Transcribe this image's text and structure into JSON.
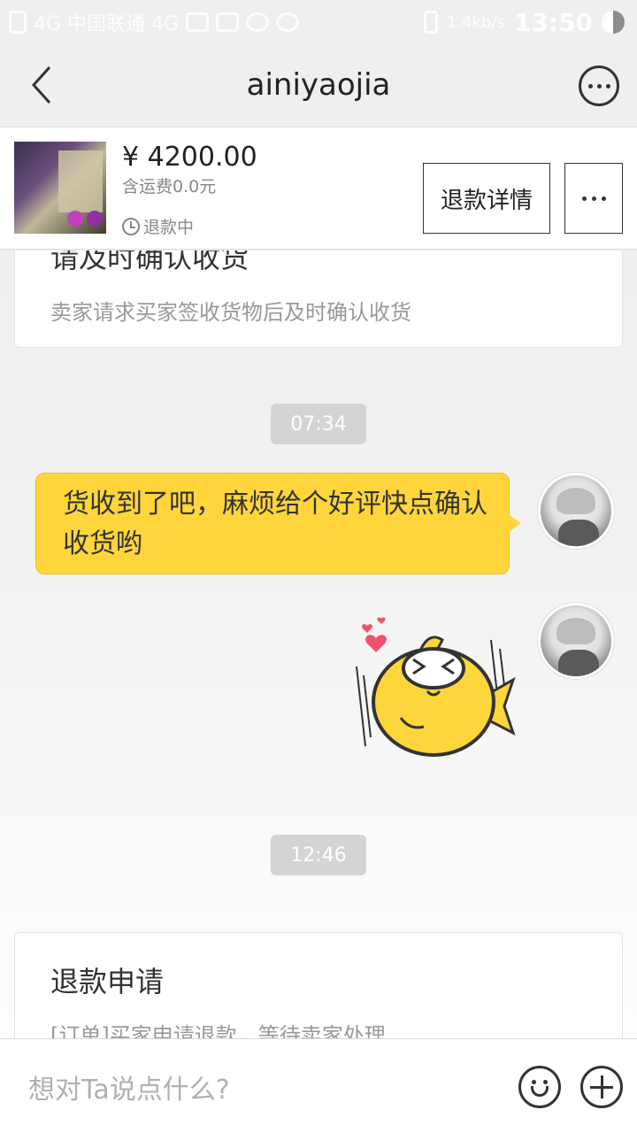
{
  "status_bar": {
    "left_text": "4G 中国联通 4G",
    "speed": "1.4kb/s",
    "time": "13:50"
  },
  "nav": {
    "title": "ainiyaojia"
  },
  "product": {
    "price": "¥ 4200.00",
    "shipping": "含运费0.0元",
    "status": "退款中",
    "refund_button": "退款详情"
  },
  "chat": {
    "card1": {
      "title": "请及时确认收货",
      "desc": "卖家请求买家签收货物后及时确认收货"
    },
    "time1": "07:34",
    "message1": "货收到了吧，麻烦给个好评快点确认收货哟",
    "time2": "12:46",
    "card2": {
      "title": "退款申请",
      "desc": "[订单]买家申请退款，等待卖家处理"
    }
  },
  "input": {
    "placeholder": "想对Ta说点什么?"
  },
  "colors": {
    "bubble": "#ffd53b",
    "sticker": "#fcd63b",
    "heart": "#f0506e"
  }
}
